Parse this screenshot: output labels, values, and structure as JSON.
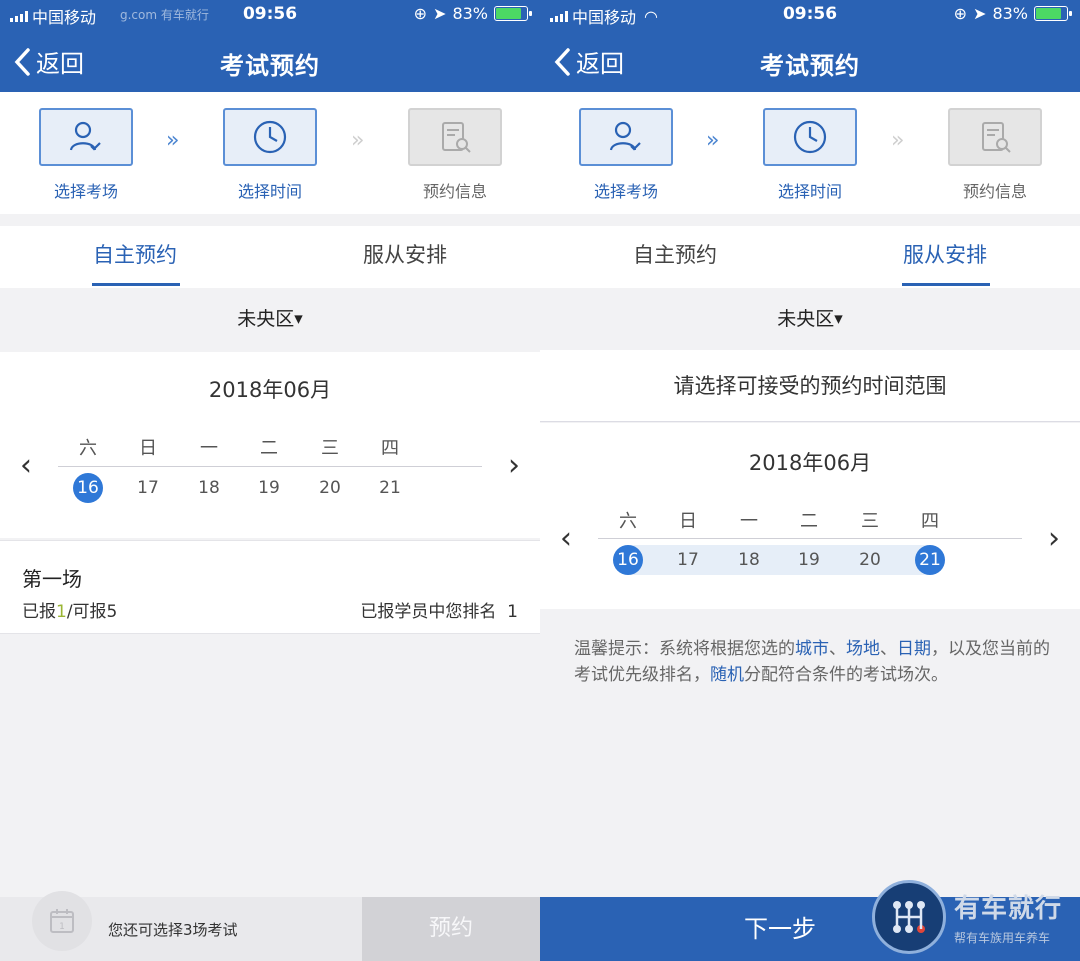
{
  "status": {
    "carrier": "中国移动",
    "time": "09:56",
    "battery": "83%",
    "battery_level": 0.83,
    "watermark": "g.com 有车就行"
  },
  "nav": {
    "back_label": "返回",
    "title": "考试预约"
  },
  "steps": [
    {
      "label": "选择考场",
      "state": "done",
      "icon": "user-check-icon"
    },
    {
      "label": "选择时间",
      "state": "current",
      "icon": "clock-icon"
    },
    {
      "label": "预约信息",
      "state": "pending",
      "icon": "document-search-icon"
    }
  ],
  "tabs": {
    "self": "自主预约",
    "assigned": "服从安排"
  },
  "district": "未央区",
  "calendar": {
    "month": "2018年06月",
    "weekdays": [
      "六",
      "日",
      "一",
      "二",
      "三",
      "四"
    ],
    "days": [
      "16",
      "17",
      "18",
      "19",
      "20",
      "21"
    ]
  },
  "left": {
    "active_tab": "self",
    "selected_days": [
      "16"
    ],
    "session": {
      "title": "第一场",
      "cap_prefix": "已报",
      "cap_booked": "1",
      "cap_suffix": "/可报5",
      "rank_text": "已报学员中您排名",
      "rank_value": "1"
    },
    "bottom": {
      "remaining": "您还可选择3场考试",
      "button": "预约"
    }
  },
  "right": {
    "active_tab": "assigned",
    "range_title": "请选择可接受的预约时间范围",
    "selected_days": [
      "16",
      "21"
    ],
    "tip": {
      "p1": "温馨提示：系统将根据您选的",
      "k1": "城市",
      "s1": "、",
      "k2": "场地",
      "s2": "、",
      "k3": "日期",
      "p2": "，以及您当前的考试优先级排名，",
      "k4": "随机",
      "p3": "分配符合条件的考试场次。"
    },
    "next_button": "下一步",
    "logo": {
      "name": "有车就行",
      "slogan": "帮有车族用车养车"
    }
  },
  "colors": {
    "brand": "#2a62b4",
    "selected_day": "#2f78d7",
    "highlight_green": "#9ab534"
  }
}
